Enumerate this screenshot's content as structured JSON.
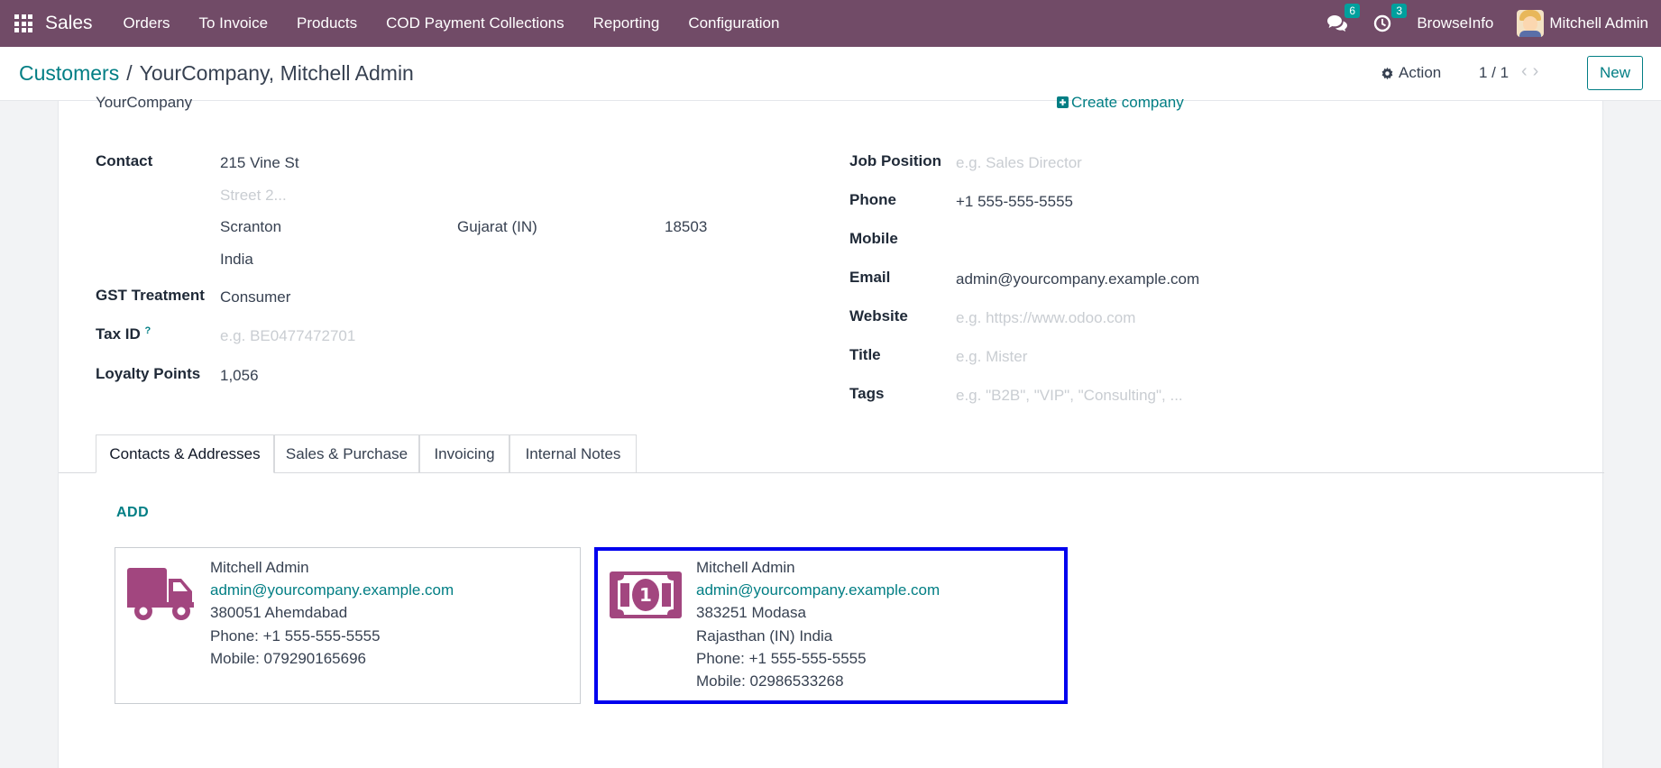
{
  "navbar": {
    "brand": "Sales",
    "menu": [
      "Orders",
      "To Invoice",
      "Products",
      "COD Payment Collections",
      "Reporting",
      "Configuration"
    ],
    "messages_count": "6",
    "activities_count": "3",
    "company": "BrowseInfo",
    "user": "Mitchell Admin",
    "bg_color": "#714b67"
  },
  "control": {
    "breadcrumb_parent": "Customers",
    "breadcrumb_sep": "/",
    "breadcrumb_current": "YourCompany, Mitchell Admin",
    "action_label": "Action",
    "pager": "1 / 1",
    "new_label": "New"
  },
  "form": {
    "company_name": "YourCompany",
    "create_company": "Create company",
    "contact_label": "Contact",
    "street": "215 Vine St",
    "street2_placeholder": "Street 2...",
    "city": "Scranton",
    "state": "Gujarat (IN)",
    "zip": "18503",
    "country": "India",
    "gst_label": "GST Treatment",
    "gst_value": "Consumer",
    "taxid_label": "Tax ID",
    "taxid_help": "?",
    "taxid_placeholder": "e.g. BE0477472701",
    "loyalty_label": "Loyalty Points",
    "loyalty_value": "1,056",
    "job_label": "Job Position",
    "job_placeholder": "e.g. Sales Director",
    "phone_label": "Phone",
    "phone_value": "+1 555-555-5555",
    "mobile_label": "Mobile",
    "email_label": "Email",
    "email_value": "admin@yourcompany.example.com",
    "website_label": "Website",
    "website_placeholder": "e.g. https://www.odoo.com",
    "title_label": "Title",
    "title_placeholder": "e.g. Mister",
    "tags_label": "Tags",
    "tags_placeholder": "e.g. \"B2B\", \"VIP\", \"Consulting\", ..."
  },
  "tabs": [
    {
      "label": "Contacts & Addresses",
      "active": true
    },
    {
      "label": "Sales & Purchase",
      "active": false
    },
    {
      "label": "Invoicing",
      "active": false
    },
    {
      "label": "Internal Notes",
      "active": false
    }
  ],
  "add_label": "ADD",
  "cards": [
    {
      "icon": "truck-icon",
      "name": "Mitchell Admin",
      "email": "admin@yourcompany.example.com",
      "lines": [
        "380051 Ahemdabad",
        "Phone: +1 555-555-5555",
        "Mobile: 079290165696"
      ]
    },
    {
      "icon": "money-bill-icon",
      "name": "Mitchell Admin",
      "email": "admin@yourcompany.example.com",
      "lines": [
        "383251 Modasa",
        "Rajasthan (IN) India",
        "Phone: +1 555-555-5555",
        "Mobile: 02986533268"
      ]
    }
  ],
  "icon_color": "#a2467f",
  "highlight_color": "#0000ee"
}
